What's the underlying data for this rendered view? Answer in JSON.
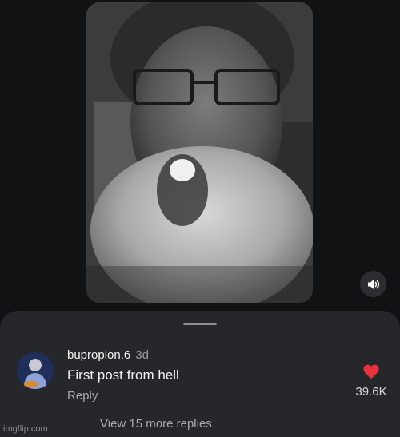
{
  "comment": {
    "username": "bupropion.6",
    "time": "3d",
    "text": "First post from hell",
    "reply_label": "Reply",
    "like_count": "39.6K"
  },
  "more_replies_label": "View 15 more replies",
  "watermark": "imgflip.com",
  "colors": {
    "like_heart": "#e8323c",
    "sheet_bg": "#25272b",
    "page_bg": "#111214"
  },
  "icons": {
    "sound": "volume-icon",
    "like": "heart-icon"
  }
}
